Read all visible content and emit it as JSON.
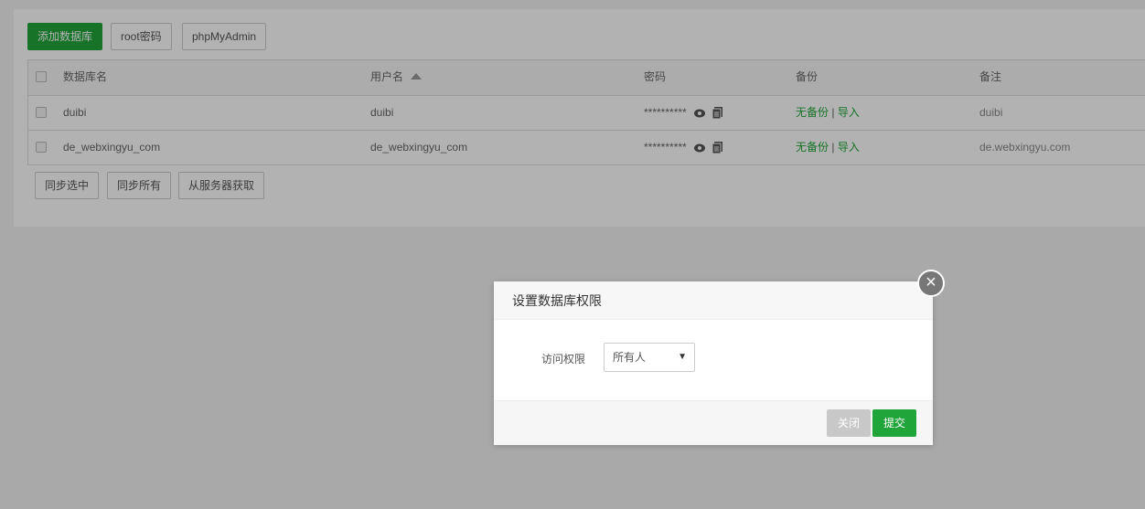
{
  "toolbar": {
    "add_db": "添加数据库",
    "root_pwd": "root密码",
    "phpmyadmin": "phpMyAdmin"
  },
  "table": {
    "headers": {
      "name": "数据库名",
      "user": "用户名",
      "password": "密码",
      "backup": "备份",
      "remark": "备注"
    },
    "rows": [
      {
        "name": "duibi",
        "user": "duibi",
        "password": "**********",
        "backup": "无备份",
        "import": "导入",
        "remark": "duibi"
      },
      {
        "name": "de_webxingyu_com",
        "user": "de_webxingyu_com",
        "password": "**********",
        "backup": "无备份",
        "import": "导入",
        "remark": "de.webxingyu.com"
      }
    ],
    "separator": "|"
  },
  "bottom": {
    "sync_selected": "同步选中",
    "sync_all": "同步所有",
    "fetch_server": "从服务器获取"
  },
  "modal": {
    "title": "设置数据库权限",
    "label": "访问权限",
    "select_value": "所有人",
    "close": "关闭",
    "submit": "提交",
    "close_icon": "×"
  },
  "colors": {
    "accent": "#20a53a"
  }
}
